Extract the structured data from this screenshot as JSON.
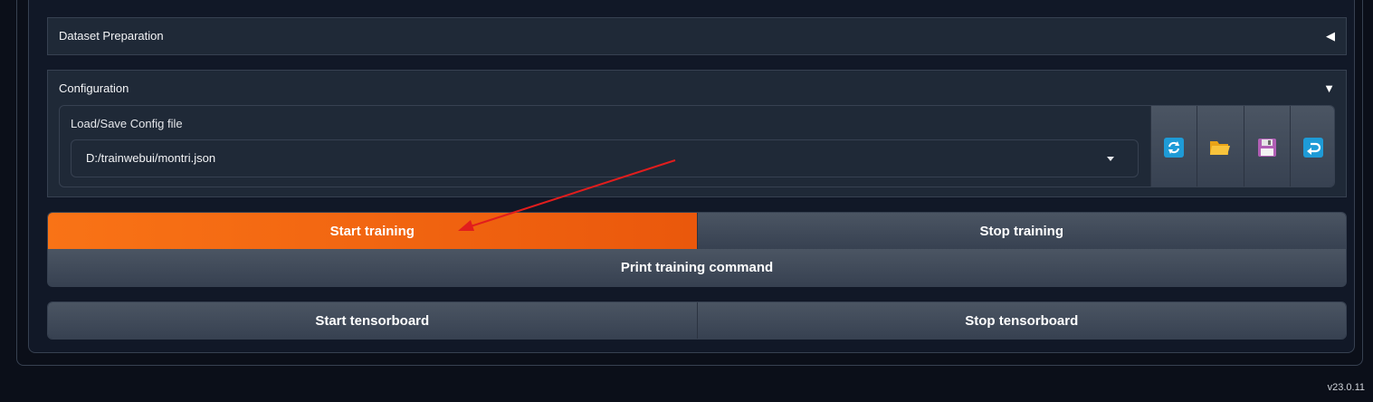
{
  "accordions": {
    "dataset": {
      "title": "Dataset Preparation",
      "toggle": "◀"
    },
    "configuration": {
      "title": "Configuration",
      "toggle": "▼"
    }
  },
  "config": {
    "label": "Load/Save Config file",
    "selected_file": "D:/trainwebui/montri.json",
    "tools": [
      {
        "icon": "refresh-icon",
        "color": "#1e9bd7"
      },
      {
        "icon": "folder-icon",
        "color": "#f5b829"
      },
      {
        "icon": "save-icon",
        "color": "#b15fb5"
      },
      {
        "icon": "return-icon",
        "color": "#1e9bd7"
      }
    ]
  },
  "actions": {
    "start_training": "Start training",
    "stop_training": "Stop training",
    "print_command": "Print training command",
    "start_tensorboard": "Start tensorboard",
    "stop_tensorboard": "Stop tensorboard"
  },
  "colors": {
    "primary": "#f97316",
    "annotation_arrow": "#e11d1d"
  },
  "version": "v23.0.11"
}
